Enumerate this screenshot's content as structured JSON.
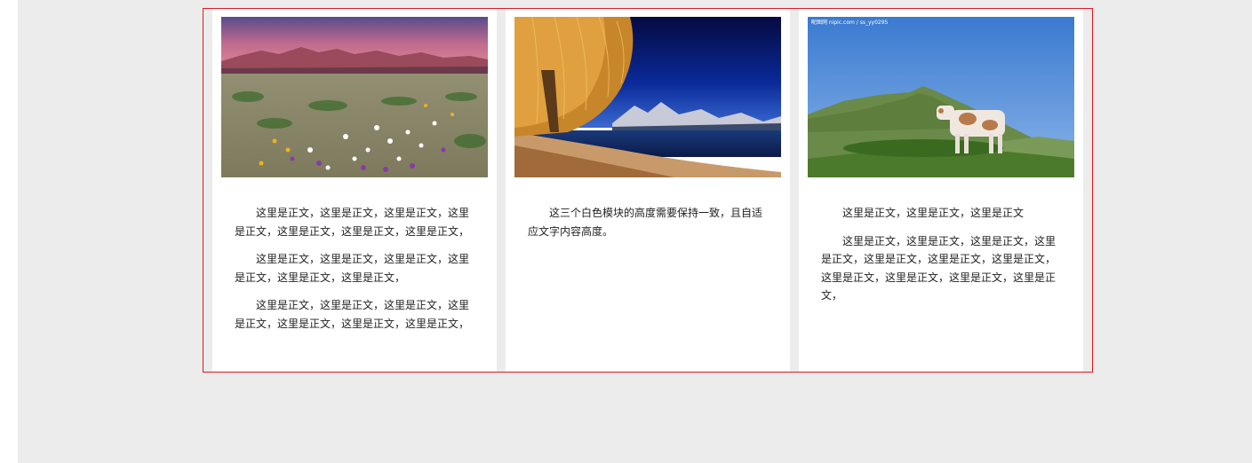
{
  "colors": {
    "page_background": "#ececec",
    "container_border": "#e0191e",
    "card_background": "#ffffff",
    "text": "#222222"
  },
  "cards": [
    {
      "image": "desert-wildflowers-mountains-photo",
      "paragraphs": [
        "这里是正文，这里是正文，这里是正文，这里是正文，这里是正文，这里是正文，这里是正文，",
        "这里是正文，这里是正文，这里是正文，这里是正文，这里是正文，这里是正文，",
        "这里是正文，这里是正文，这里是正文，这里是正文，这里是正文，这里是正文，这里是正文，"
      ]
    },
    {
      "image": "lake-willow-tree-mountains-photo",
      "paragraphs": [
        "这三个白色模块的高度需要保持一致，且自适应文字内容高度。"
      ]
    },
    {
      "image": "cow-on-mountain-hill-photo",
      "watermark": "昵图网 nipic.com / ss_yy0295",
      "paragraphs": [
        "这里是正文，这里是正文，这里是正文",
        "这里是正文，这里是正文，这里是正文，这里是正文，这里是正文，这里是正文，这里是正文，这里是正文，这里是正文，这里是正文，这里是正文，"
      ]
    }
  ]
}
